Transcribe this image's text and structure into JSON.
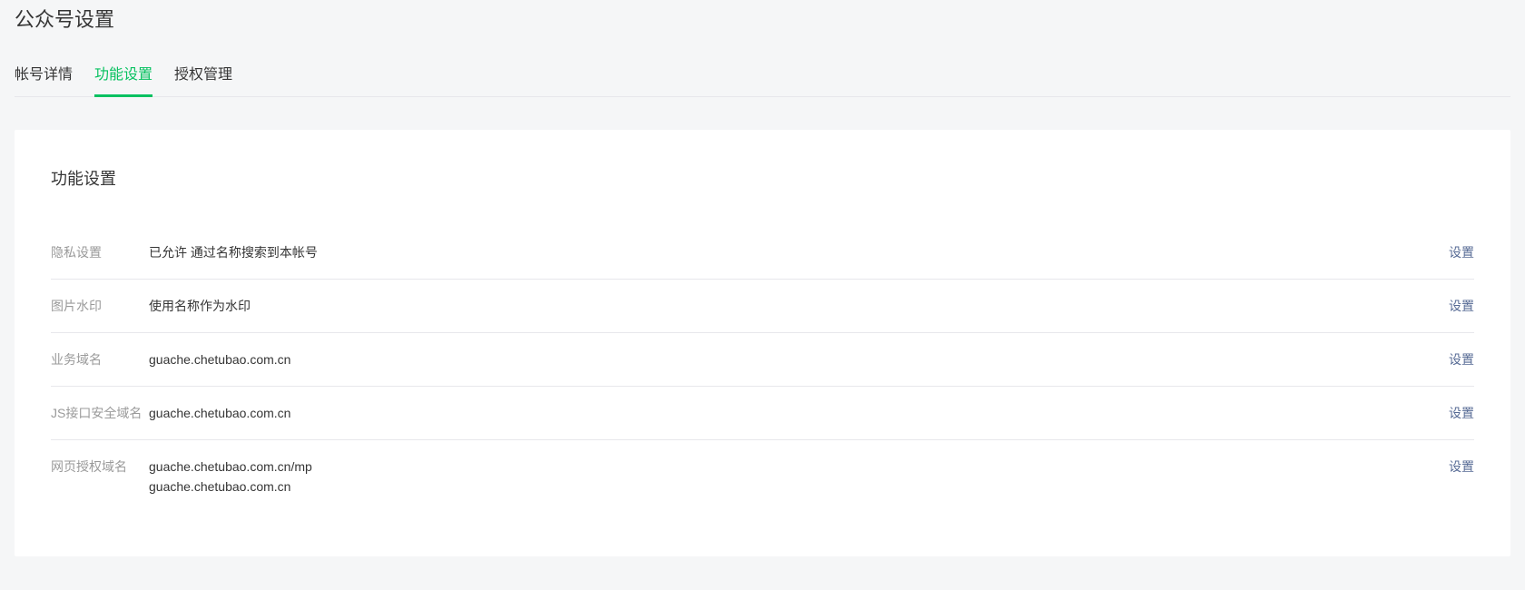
{
  "header": {
    "title": "公众号设置"
  },
  "tabs": [
    {
      "label": "帐号详情",
      "active": false
    },
    {
      "label": "功能设置",
      "active": true
    },
    {
      "label": "授权管理",
      "active": false
    }
  ],
  "section": {
    "title": "功能设置",
    "rows": [
      {
        "label": "隐私设置",
        "value": "已允许 通过名称搜索到本帐号",
        "action": "设置"
      },
      {
        "label": "图片水印",
        "value": "使用名称作为水印",
        "action": "设置"
      },
      {
        "label": "业务域名",
        "value": "guache.chetubao.com.cn",
        "action": "设置"
      },
      {
        "label": "JS接口安全域名",
        "value": "guache.chetubao.com.cn",
        "action": "设置"
      },
      {
        "label": "网页授权域名",
        "value": "guache.chetubao.com.cn/mp\nguache.chetubao.com.cn",
        "action": "设置"
      }
    ]
  }
}
